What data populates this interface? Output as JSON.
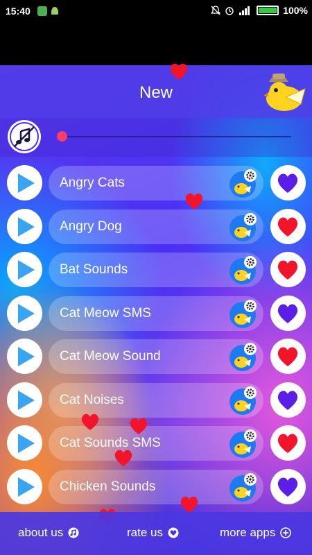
{
  "status_bar": {
    "time": "15:40",
    "battery": "100%",
    "icons": [
      "gallery-app-icon",
      "android-icon",
      "bell-off-icon",
      "alarm-icon",
      "signal-icon",
      "battery-charging-icon"
    ]
  },
  "header": {
    "title": "New",
    "logo_icon": "yellow-bird-with-hat-icon"
  },
  "player": {
    "music_icon": "music-note-off-icon",
    "seek_progress": 0.0
  },
  "sounds": [
    {
      "label": "Angry Cats",
      "favorite": false
    },
    {
      "label": "Angry Dog",
      "favorite": true
    },
    {
      "label": "Bat Sounds",
      "favorite": true
    },
    {
      "label": "Cat Meow SMS",
      "favorite": false
    },
    {
      "label": "Cat Meow Sound",
      "favorite": true
    },
    {
      "label": "Cat Noises",
      "favorite": false
    },
    {
      "label": "Cat Sounds SMS",
      "favorite": true
    },
    {
      "label": "Chicken Sounds",
      "favorite": false
    }
  ],
  "footer": {
    "about_label": "about us",
    "rate_label": "rate us",
    "more_label": "more apps"
  },
  "colors": {
    "accent": "#4a2ff5",
    "play": "#3aa4f0",
    "heart_fav": "#f1142a",
    "heart_empty": "#5a1ee8",
    "seek_thumb": "#ff3d6a"
  }
}
